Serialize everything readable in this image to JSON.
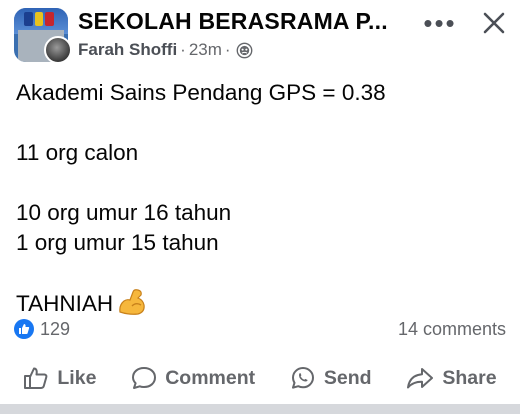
{
  "post": {
    "group_name": "SEKOLAH BERASRAMA P...",
    "author": "Farah Shoffi",
    "time": "23m",
    "dot": "·",
    "audience_icon": "globe-icon",
    "more_label": "•••",
    "lines": [
      "Akademi Sains Pendang GPS = 0.38",
      "",
      "11 org calon",
      "",
      "10 org umur 16 tahun",
      "1 org umur 15 tahun",
      "",
      "TAHNIAH"
    ],
    "emoji": "flexed-biceps-emoji"
  },
  "stats": {
    "reaction_icon": "thumbs-up-icon",
    "reactions": "129",
    "comments": "14 comments"
  },
  "actions": {
    "like": "Like",
    "comment": "Comment",
    "send": "Send",
    "share": "Share"
  },
  "colors": {
    "accent": "#1877f2",
    "secondary_text": "#65676b",
    "primary_text": "#050505"
  }
}
